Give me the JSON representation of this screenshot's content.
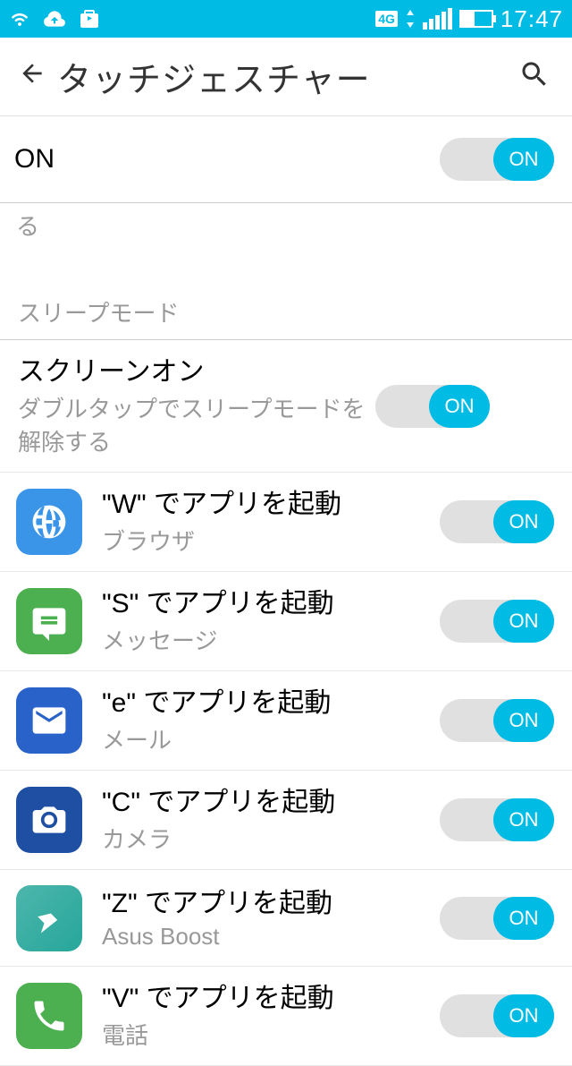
{
  "status_bar": {
    "network_label": "4G",
    "time": "17:47"
  },
  "header": {
    "title": "タッチジェスチャー"
  },
  "master": {
    "label": "ON",
    "toggle_label": "ON"
  },
  "partial_cutoff": "る",
  "section": {
    "sleep_mode": "スリープモード"
  },
  "screen_on": {
    "title": "スクリーンオン",
    "subtitle": "ダブルタップでスリープモードを解除する",
    "toggle_label": "ON"
  },
  "gestures": [
    {
      "title": "\"W\" でアプリを起動",
      "subtitle": "ブラウザ",
      "toggle_label": "ON",
      "icon_type": "browser"
    },
    {
      "title": "\"S\" でアプリを起動",
      "subtitle": "メッセージ",
      "toggle_label": "ON",
      "icon_type": "message"
    },
    {
      "title": "\"e\" でアプリを起動",
      "subtitle": "メール",
      "toggle_label": "ON",
      "icon_type": "mail"
    },
    {
      "title": "\"C\" でアプリを起動",
      "subtitle": "カメラ",
      "toggle_label": "ON",
      "icon_type": "camera"
    },
    {
      "title": "\"Z\" でアプリを起動",
      "subtitle": "Asus Boost",
      "toggle_label": "ON",
      "icon_type": "boost"
    },
    {
      "title": "\"V\" でアプリを起動",
      "subtitle": "電話",
      "toggle_label": "ON",
      "icon_type": "phone"
    }
  ]
}
